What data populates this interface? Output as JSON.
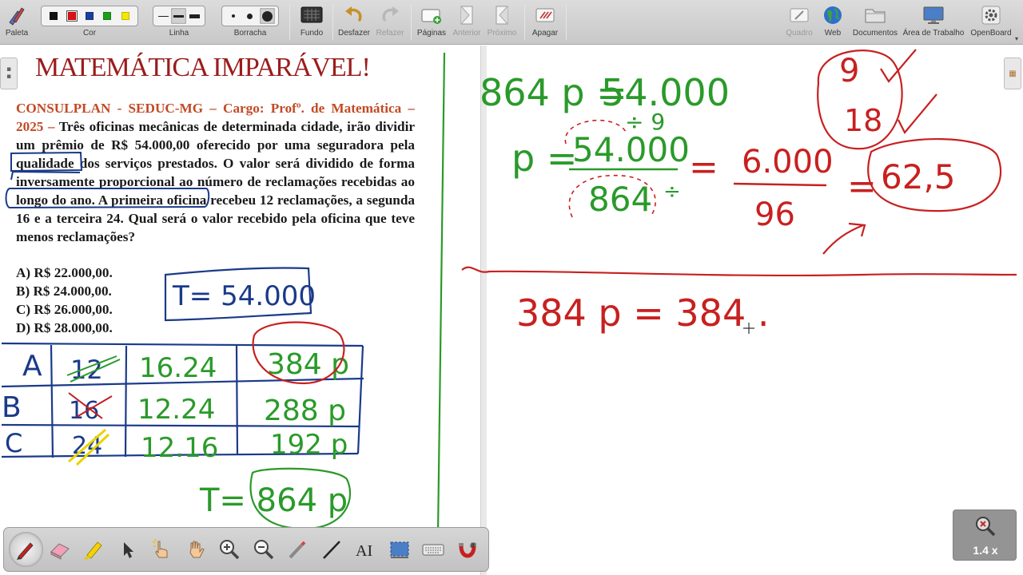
{
  "toolbar": {
    "palette_label": "Paleta",
    "color_label": "Cor",
    "line_label": "Linha",
    "eraser_label": "Borracha",
    "background_label": "Fundo",
    "undo_label": "Desfazer",
    "redo_label": "Refazer",
    "pages_label": "Páginas",
    "previous_label": "Anterior",
    "next_label": "Próximo",
    "erase_label": "Apagar",
    "board_label": "Quadro",
    "web_label": "Web",
    "documents_label": "Documentos",
    "desktop_label": "Área de Trabalho",
    "openboard_label": "OpenBoard",
    "colors": [
      "#111111",
      "#e01010",
      "#1a3fa0",
      "#1aa01a",
      "#f5e600"
    ],
    "selected_color": 1
  },
  "document": {
    "title": "MATEMÁTICA IMPARÁVEL!",
    "question": {
      "source": "CONSULPLAN - SEDUC-MG – Cargo: Profº. de Matemática – 2025 –",
      "text": "Três oficinas mecânicas de determinada cidade, irão dividir um prêmio de R$ 54.000,00 oferecido por uma seguradora pela qualidade dos serviços prestados. O valor será dividido de forma inversamente proporcional ao número de reclamações recebidas ao longo do ano. A primeira oficina recebeu 12 reclamações, a segunda 16 e a terceira 24. Qual será o valor recebido pela oficina que teve menos reclamações?"
    },
    "options": [
      "A) R$ 22.000,00.",
      "B) R$ 24.000,00.",
      "C) R$ 26.000,00.",
      "D) R$ 28.000,00."
    ]
  },
  "handwriting": {
    "total": "T= 54.000",
    "table": {
      "rows": [
        {
          "label": "A",
          "count": "12",
          "product": "16.24",
          "value": "384 p"
        },
        {
          "label": "B",
          "count": "16",
          "product": "12.24",
          "value": "288 p"
        },
        {
          "label": "C",
          "count": "24",
          "product": "12.16",
          "value": "192 p"
        }
      ]
    },
    "sum": "T= 864 p",
    "eq1_left": "864 p =",
    "eq1_right": "54.000",
    "div9": "÷ 9",
    "p_eq": "p =",
    "fraction_num": "54.000",
    "fraction_den": "864",
    "div_sign": "÷",
    "equals": "=",
    "frac2_num": "6.000",
    "frac2_den": "96",
    "equals2": "=",
    "result": "62,5",
    "factor_top": "9",
    "factor_bottom": "18",
    "eq2": "384 p = 384 ."
  },
  "palette_tools": [
    "pen-tool",
    "eraser-tool",
    "marker-tool",
    "selector-tool",
    "interact-tool",
    "hand-tool",
    "zoom-in-tool",
    "zoom-out-tool",
    "laser-pointer-tool",
    "line-tool",
    "text-tool",
    "capture-tool",
    "virtual-keyboard-tool",
    "magnifier-tool"
  ],
  "zoom": {
    "label": "1.4 x"
  }
}
